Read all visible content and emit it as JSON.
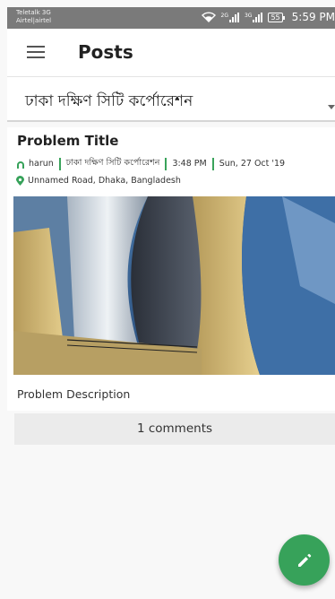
{
  "status_bar": {
    "carrier_line1": "Teletalk 3G",
    "carrier_line2": "Airtel|airtel",
    "net1": "2G",
    "net2": "3G",
    "battery": "55",
    "time": "5:59 PM"
  },
  "app_bar": {
    "title": "Posts",
    "menu_icon": "hamburger-menu-icon"
  },
  "area_selector": {
    "selected": "ঢাকা দক্ষিণ সিটি কর্পোরেশন",
    "icon": "dropdown-caret-icon"
  },
  "post": {
    "title": "Problem Title",
    "user": "harun",
    "area": "ঢাকা দক্ষিণ সিটি কর্পোরেশন",
    "time": "3:48 PM",
    "date": "Sun, 27 Oct '19",
    "location": "Unnamed Road, Dhaka, Bangladesh",
    "description": "Problem Description",
    "comments_label": "1 comments"
  },
  "colors": {
    "accent": "#37a25a",
    "status_bar": "#7a7a7a"
  },
  "fab": {
    "icon": "pencil-edit-icon"
  }
}
